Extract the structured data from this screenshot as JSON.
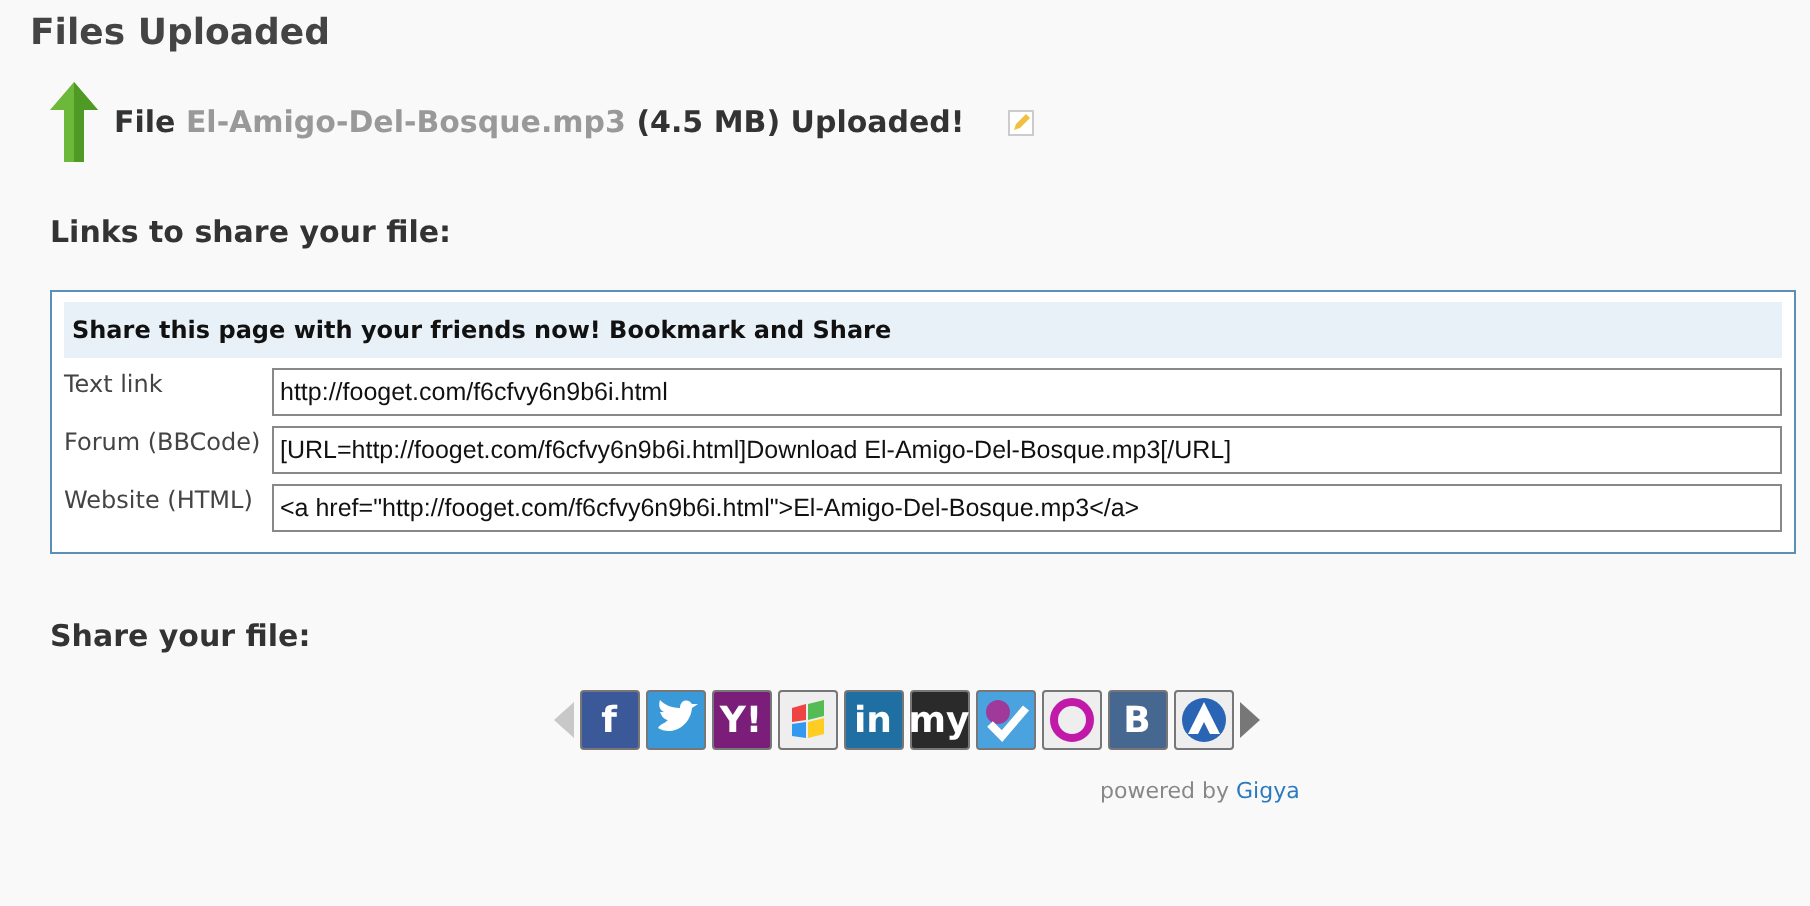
{
  "title": "Files Uploaded",
  "upload": {
    "prefix": "File",
    "filename": "El-Amigo-Del-Bosque.mp3",
    "suffix": "(4.5 MB) Uploaded!"
  },
  "links_heading": "Links to share your file:",
  "share_box": {
    "header": "Share this page with your friends now! Bookmark and Share",
    "rows": [
      {
        "label": "Text link",
        "value": "http://fooget.com/f6cfvy6n9b6i.html"
      },
      {
        "label": "Forum (BBCode)",
        "value": "[URL=http://fooget.com/f6cfvy6n9b6i.html]Download El-Amigo-Del-Bosque.mp3[/URL]"
      },
      {
        "label": "Website (HTML)",
        "value": "<a href=\"http://fooget.com/f6cfvy6n9b6i.html\">El-Amigo-Del-Bosque.mp3</a>"
      }
    ]
  },
  "share_heading": "Share your file:",
  "share_bar": {
    "prev_disabled": true,
    "next_disabled": false,
    "services": [
      {
        "kind": "letter",
        "glyph": "f",
        "color": "#3b5998"
      },
      {
        "kind": "bird",
        "color": "#3a9ad9"
      },
      {
        "kind": "letter",
        "glyph": "Y!",
        "color": "#7b1e7a"
      },
      {
        "kind": "flag",
        "color": "#eeeeee"
      },
      {
        "kind": "letter",
        "glyph": "in",
        "color": "#1f6fa3"
      },
      {
        "kind": "letter",
        "glyph": "my",
        "color": "#2a2a2a"
      },
      {
        "kind": "check",
        "color": "#4aa3df"
      },
      {
        "kind": "ring",
        "color": "#eeeeee"
      },
      {
        "kind": "letter",
        "glyph": "B",
        "color": "#46678f"
      },
      {
        "kind": "peak",
        "color": "#eeeeee"
      }
    ]
  },
  "powered": {
    "text": "powered by",
    "brand": "Gigya"
  }
}
